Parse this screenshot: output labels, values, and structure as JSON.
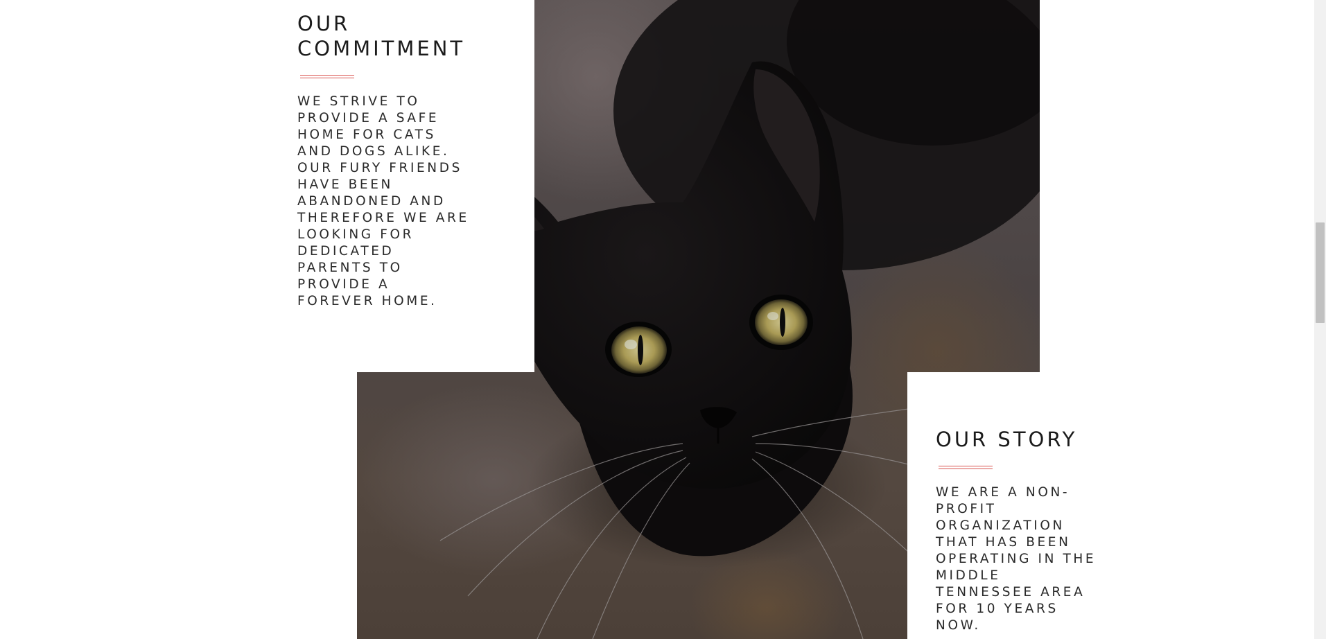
{
  "commitment": {
    "title_line1": "OUR",
    "title_line2": "COMMITMENT",
    "body": "WE STRIVE TO PROVIDE A SAFE HOME FOR CATS AND DOGS ALIKE. OUR FURY FRIENDS HAVE BEEN ABANDONED AND THEREFORE WE ARE LOOKING FOR DEDICATED PARENTS TO PROVIDE A FOREVER HOME."
  },
  "story": {
    "title": "OUR STORY",
    "body": "WE ARE A NON-PROFIT ORGANIZATION THAT HAS BEEN OPERATING IN THE MIDDLE TENNESSEE AREA FOR 10 YEARS NOW."
  },
  "photo": {
    "subject": "black-cat"
  },
  "colors": {
    "accent": "#d9534f",
    "text": "#1f1f1f",
    "background": "#ffffff"
  }
}
